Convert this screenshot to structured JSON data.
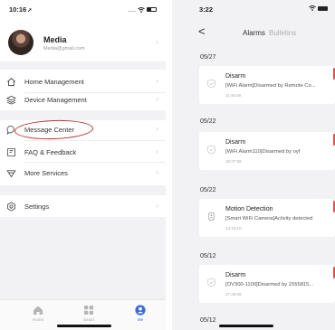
{
  "left": {
    "status_time": "10:16",
    "status_arrow": "➚",
    "status_right": "....",
    "profile": {
      "name": "Media",
      "email": "Media@gmail.com"
    },
    "menu": [
      {
        "label": "Home Management",
        "icon": "home-icon"
      },
      {
        "label": "Device Management",
        "icon": "layers-icon"
      },
      {
        "label": "Message Center",
        "icon": "chat-icon"
      },
      {
        "label": "FAQ & Feedback",
        "icon": "feedback-icon"
      },
      {
        "label": "More Services",
        "icon": "services-icon"
      },
      {
        "label": "Settings",
        "icon": "gear-icon"
      }
    ],
    "tabs": [
      {
        "label": "Home",
        "icon": "house-icon"
      },
      {
        "label": "Smart",
        "icon": "grid-icon"
      },
      {
        "label": "Me",
        "icon": "person-icon"
      }
    ],
    "accent": "#3b6ad6",
    "highlight_color": "#b8312f"
  },
  "right": {
    "status_time": "3:22",
    "back": "<",
    "tab_alarms": "Alarms",
    "tab_bulletins": "Bulletins",
    "groups": [
      {
        "date": "05/27",
        "title": "Disarm",
        "desc": "[WiFi Alarm]Disarmed by Remote Co...",
        "time": "11:46:59",
        "icon": "shield-check-icon"
      },
      {
        "date": "05/22",
        "title": "Disarm",
        "desc": "[WiFi Alarm110]Disarmed by oyf",
        "time": "15:37:59",
        "icon": "shield-check-icon"
      },
      {
        "date": "05/22",
        "title": "Motion Detection",
        "desc": "[Smart WiFi Camera]Activity detected",
        "time": "14:34:10",
        "icon": "motion-sensor-icon"
      },
      {
        "date": "05/12",
        "title": "Disarm",
        "desc": "[OV300-1100]Disarmed by 1555815...",
        "time": "17:26:59",
        "icon": "shield-check-icon"
      },
      {
        "date": "05/12"
      }
    ],
    "alert_color": "#d9534f"
  }
}
